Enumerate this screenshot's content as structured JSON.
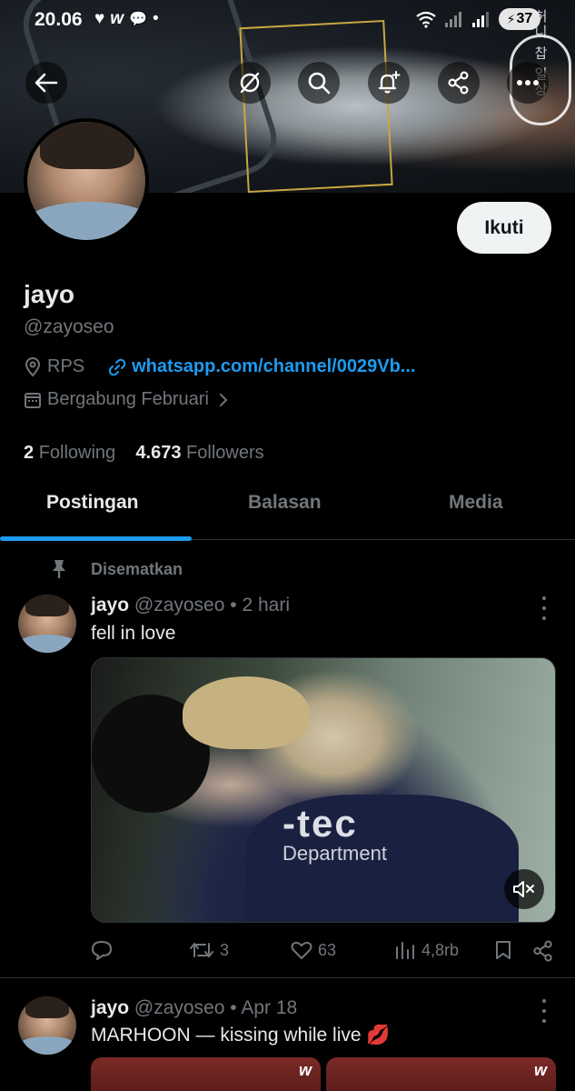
{
  "status_bar": {
    "time": "20.06",
    "notif_heart": "♥",
    "notif_app": "w",
    "notif_chat": "💬",
    "notif_dot": "•",
    "battery": "37"
  },
  "banner": {
    "side_text": "허니 찹 일상"
  },
  "profile": {
    "follow_label": "Ikuti",
    "name": "jayo",
    "handle": "@zayoseo",
    "location": "RPS",
    "link": "whatsapp.com/channel/0029Vb...",
    "joined": "Bergabung Februari",
    "following_count": "2",
    "following_label": "Following",
    "followers_count": "4.673",
    "followers_label": "Followers"
  },
  "tabs": [
    {
      "label": "Postingan"
    },
    {
      "label": "Balasan"
    },
    {
      "label": "Media"
    }
  ],
  "pinned_label": "Disematkan",
  "tweets": [
    {
      "name": "jayo",
      "handle": "@zayoseo",
      "sep": "•",
      "time": "2 hari",
      "text": "fell in love",
      "media_text_1": "-tec",
      "media_text_2": "Department",
      "retweets": "3",
      "likes": "63",
      "views": "4,8rb"
    },
    {
      "name": "jayo",
      "handle": "@zayoseo",
      "sep": "•",
      "time": "Apr 18",
      "text": "MARHOON — kissing while live 💋",
      "thumb_watermark": "w"
    }
  ],
  "colors": {
    "accent": "#1d9bf0",
    "background": "#000000",
    "muted": "#71767b"
  }
}
